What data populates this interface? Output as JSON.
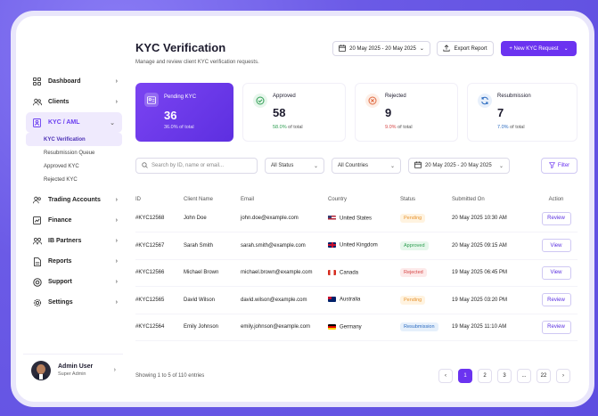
{
  "header": {
    "title": "KYC Verification",
    "subtitle": "Manage and review client KYC verification requests.",
    "date_range": "20 May 2025 - 20 May 2025",
    "export_label": "Export Report",
    "new_request_label": "+ New KYC Request"
  },
  "sidebar": {
    "items": [
      {
        "label": "Dashboard",
        "icon": "grid-icon"
      },
      {
        "label": "Clients",
        "icon": "users-icon"
      },
      {
        "label": "KYC / AML",
        "icon": "id-card-icon"
      },
      {
        "label": "Trading Accounts",
        "icon": "users-icon"
      },
      {
        "label": "Finance",
        "icon": "chart-icon"
      },
      {
        "label": "IB Partners",
        "icon": "partners-icon"
      },
      {
        "label": "Reports",
        "icon": "document-icon"
      },
      {
        "label": "Support",
        "icon": "support-icon"
      },
      {
        "label": "Settings",
        "icon": "gear-icon"
      }
    ],
    "submenu": [
      "KYC Verification",
      "Resubmission Queue",
      "Approved KYC",
      "Rejected KYC"
    ],
    "user": {
      "name": "Admin User",
      "role": "Super Admin"
    }
  },
  "stats": {
    "pending": {
      "label": "Pending KYC",
      "value": "36",
      "sub": "36.0% of total"
    },
    "approved": {
      "label": "Approved",
      "value": "58",
      "pct": "58.0%",
      "sub": "of total"
    },
    "rejected": {
      "label": "Rejected",
      "value": "9",
      "pct": "9.0%",
      "sub": "of total"
    },
    "resubmission": {
      "label": "Resubmission",
      "value": "7",
      "pct": "7.0%",
      "sub": "of total"
    }
  },
  "filters": {
    "search_placeholder": "Search by ID, name or email...",
    "status": "All Status",
    "country": "All Countries",
    "date_range": "20 May 2025 - 20 May 2025",
    "filter_label": "Filter"
  },
  "table": {
    "headers": [
      "ID",
      "Client Name",
      "Email",
      "Country",
      "Status",
      "Submitted On",
      "Action"
    ],
    "rows": [
      {
        "id": "#KYC12568",
        "name": "John Doe",
        "email": "john.doe@example.com",
        "country": "United States",
        "status": "Pending",
        "submitted": "20 May 2025 10:30 AM",
        "action": "Review"
      },
      {
        "id": "#KYC12567",
        "name": "Sarah Smith",
        "email": "sarah.smith@example.com",
        "country": "United Kingdom",
        "status": "Approved",
        "submitted": "20 May 2025 09:15 AM",
        "action": "View"
      },
      {
        "id": "#KYC12566",
        "name": "Michael Brown",
        "email": "michael.brown@example.com",
        "country": "Canada",
        "status": "Rejected",
        "submitted": "19 May 2025 06:45 PM",
        "action": "View"
      },
      {
        "id": "#KYC12565",
        "name": "David Wilson",
        "email": "david.wilson@example.com",
        "country": "Australia",
        "status": "Pending",
        "submitted": "19 May 2025 03:20 PM",
        "action": "Review"
      },
      {
        "id": "#KYC12564",
        "name": "Emily Johnson",
        "email": "emily.johnson@example.com",
        "country": "Germany",
        "status": "Resubmission",
        "submitted": "19 May 2025 11:10 AM",
        "action": "Review"
      }
    ]
  },
  "pagination": {
    "summary": "Showing 1 to 5 of 110 entries",
    "pages": [
      "1",
      "2",
      "3",
      "...",
      "22"
    ],
    "prev": "‹",
    "next": "›"
  },
  "colors": {
    "accent": "#6b33f0",
    "approved": "#2e9e52",
    "rejected": "#d64545",
    "resubmission": "#2d6cc0",
    "pending": "#e7932f"
  }
}
